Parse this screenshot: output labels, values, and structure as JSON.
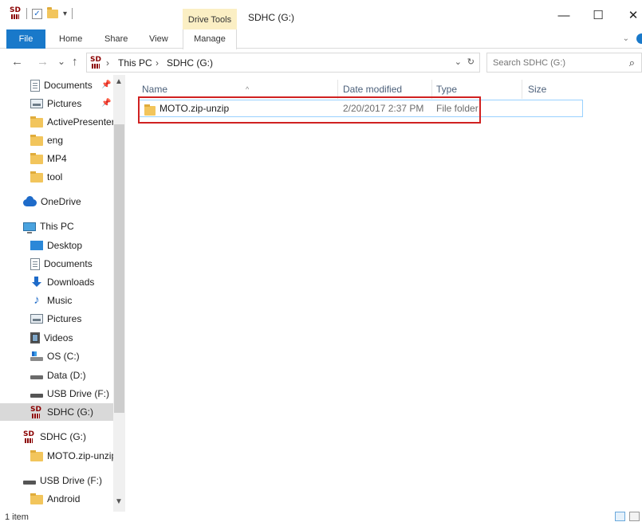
{
  "window": {
    "title": "SDHC (G:)",
    "context_tab_group": "Drive Tools",
    "controls": {
      "minimize": "—",
      "maximize": "☐",
      "close": "✕"
    }
  },
  "quick_access": {
    "dropdown": "▾"
  },
  "ribbon": {
    "tabs": [
      {
        "label": "File"
      },
      {
        "label": "Home"
      },
      {
        "label": "Share"
      },
      {
        "label": "View"
      },
      {
        "label": "Manage"
      }
    ],
    "expand_chevron": "⌄"
  },
  "nav_buttons": {
    "back": "←",
    "forward": "→",
    "recent": "⌄",
    "up": "↑"
  },
  "address": {
    "crumbs": [
      "This PC",
      "SDHC (G:)"
    ],
    "separator": "›",
    "dropdown": "⌄",
    "refresh": "↻"
  },
  "search": {
    "placeholder": "Search SDHC (G:)"
  },
  "logo": {
    "text": "SD"
  },
  "nav_pane": {
    "items": [
      {
        "label": "Documents",
        "icon": "documents-icon",
        "pinned": true
      },
      {
        "label": "Pictures",
        "icon": "pictures-icon",
        "pinned": true
      },
      {
        "label": "ActivePresenter",
        "icon": "folder-icon"
      },
      {
        "label": "eng",
        "icon": "folder-icon"
      },
      {
        "label": "MP4",
        "icon": "folder-icon"
      },
      {
        "label": "tool",
        "icon": "folder-icon"
      },
      {
        "label": "OneDrive",
        "icon": "onedrive-icon"
      },
      {
        "label": "This PC",
        "icon": "this-pc-icon"
      },
      {
        "label": "Desktop",
        "icon": "desktop-icon"
      },
      {
        "label": "Documents",
        "icon": "documents-icon"
      },
      {
        "label": "Downloads",
        "icon": "downloads-icon"
      },
      {
        "label": "Music",
        "icon": "music-icon"
      },
      {
        "label": "Pictures",
        "icon": "pictures-icon"
      },
      {
        "label": "Videos",
        "icon": "videos-icon"
      },
      {
        "label": "OS (C:)",
        "icon": "os-drive-icon"
      },
      {
        "label": "Data (D:)",
        "icon": "drive-icon"
      },
      {
        "label": "USB Drive (F:)",
        "icon": "usb-drive-icon"
      },
      {
        "label": "SDHC (G:)",
        "icon": "sd-card-icon",
        "selected": true
      },
      {
        "label": "SDHC (G:)",
        "icon": "sd-card-icon"
      },
      {
        "label": "MOTO.zip-unzip",
        "icon": "folder-icon"
      },
      {
        "label": "USB Drive (F:)",
        "icon": "usb-drive-icon"
      },
      {
        "label": "Android",
        "icon": "folder-icon"
      }
    ],
    "pin_glyph": "📌",
    "scroll_up": "▲",
    "scroll_down": "▼"
  },
  "file_list": {
    "columns": [
      "Name",
      "Date modified",
      "Type",
      "Size"
    ],
    "sort_indicator": "^",
    "rows": [
      {
        "name": "MOTO.zip-unzip",
        "date_modified": "2/20/2017 2:37 PM",
        "type": "File folder",
        "size": ""
      }
    ]
  },
  "status_bar": {
    "item_count": "1 item"
  },
  "colors": {
    "accent": "#1979ca",
    "drive_tools_bg": "#fbefc4",
    "selection_border": "#99d1ff",
    "highlight_box": "#d02121",
    "folder": "#f2c55c"
  }
}
